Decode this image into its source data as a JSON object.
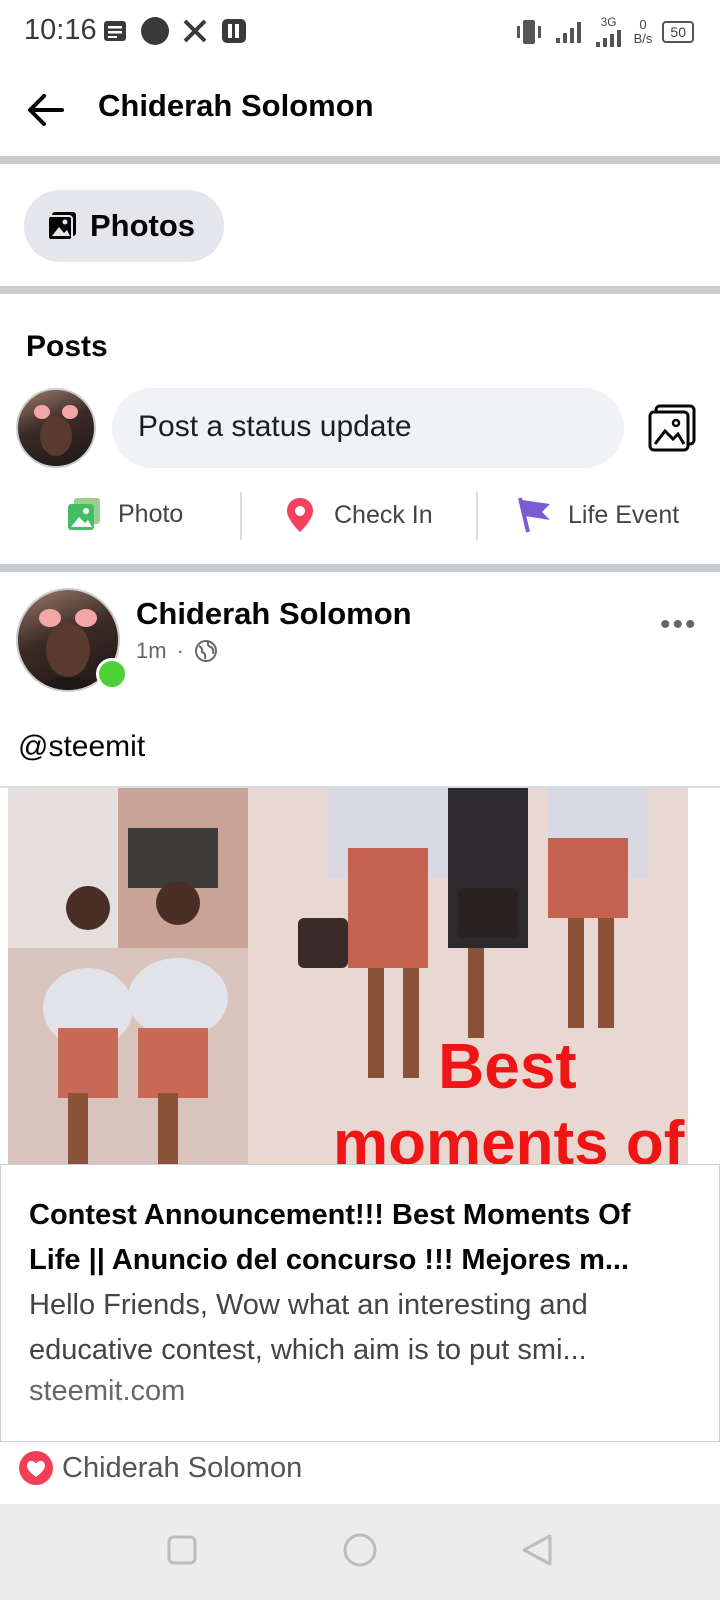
{
  "status_bar": {
    "time": "10:16",
    "network_type": "3G",
    "speed_value": "0",
    "speed_unit": "B/s",
    "battery": "50"
  },
  "header": {
    "title": "Chiderah Solomon"
  },
  "photos_chip": {
    "label": "Photos"
  },
  "posts": {
    "heading": "Posts",
    "composer_placeholder": "Post a status update",
    "actions": [
      {
        "label": "Photo"
      },
      {
        "label": "Check In"
      },
      {
        "label": "Life Event"
      }
    ]
  },
  "post": {
    "author": "Chiderah Solomon",
    "time": "1m",
    "separator": "·",
    "text": "@steemit",
    "image_overlay_line1": "Best",
    "image_overlay_line2": "moments of",
    "link_card": {
      "title": "Contest Announcement!!! Best Moments Of Life || Anuncio del concurso !!! Mejores m...",
      "description": "Hello Friends, Wow what an interesting and educative contest, which aim is to put smi...",
      "source": "steemit.com"
    },
    "reaction_name": "Chiderah Solomon"
  },
  "colors": {
    "accent_green": "#45bd62",
    "check_in_red": "#f3425f",
    "life_event_purple": "#7c5cd6",
    "online_green": "#4cd137"
  }
}
